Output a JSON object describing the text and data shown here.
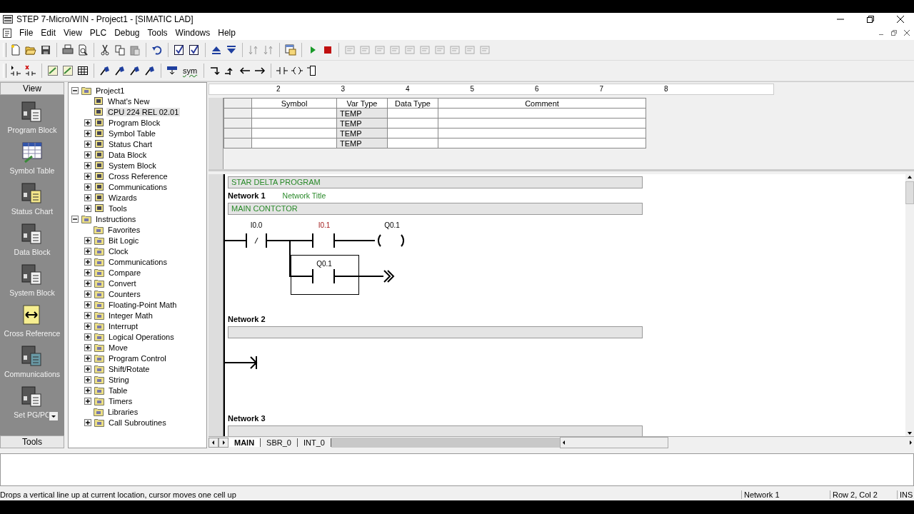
{
  "window": {
    "title": "STEP 7-Micro/WIN - Project1 - [SIMATIC LAD]"
  },
  "menu": [
    "File",
    "Edit",
    "View",
    "PLC",
    "Debug",
    "Tools",
    "Windows",
    "Help"
  ],
  "toolbar": {
    "symbol_button": "sym"
  },
  "navigation_bar": {
    "header": "View",
    "footer": "Tools",
    "items": [
      {
        "label": "Program Block"
      },
      {
        "label": "Symbol Table"
      },
      {
        "label": "Status Chart"
      },
      {
        "label": "Data Block"
      },
      {
        "label": "System Block"
      },
      {
        "label": "Cross Reference"
      },
      {
        "label": "Communications"
      },
      {
        "label": "Set PG/PC"
      }
    ]
  },
  "tree": [
    {
      "label": "Project1",
      "kind": "group",
      "expanded": true,
      "selected": false,
      "children": [
        {
          "label": "What's New",
          "kind": "leaf",
          "selected": false
        },
        {
          "label": "CPU 224 REL 02.01",
          "kind": "leaf",
          "selected": true
        },
        {
          "label": "Program Block",
          "kind": "group",
          "expanded": false,
          "selected": false
        },
        {
          "label": "Symbol Table",
          "kind": "group",
          "expanded": false,
          "selected": false
        },
        {
          "label": "Status Chart",
          "kind": "group",
          "expanded": false,
          "selected": false
        },
        {
          "label": "Data Block",
          "kind": "group",
          "expanded": false,
          "selected": false
        },
        {
          "label": "System Block",
          "kind": "group",
          "expanded": false,
          "selected": false
        },
        {
          "label": "Cross Reference",
          "kind": "group",
          "expanded": false,
          "selected": false
        },
        {
          "label": "Communications",
          "kind": "group",
          "expanded": false,
          "selected": false
        },
        {
          "label": "Wizards",
          "kind": "group",
          "expanded": false,
          "selected": false
        },
        {
          "label": "Tools",
          "kind": "group",
          "expanded": false,
          "selected": false
        }
      ]
    },
    {
      "label": "Instructions",
      "kind": "group",
      "expanded": true,
      "selected": false,
      "children": [
        {
          "label": "Favorites",
          "kind": "leaf",
          "selected": false
        },
        {
          "label": "Bit Logic",
          "kind": "group",
          "expanded": false,
          "selected": false
        },
        {
          "label": "Clock",
          "kind": "group",
          "expanded": false,
          "selected": false
        },
        {
          "label": "Communications",
          "kind": "group",
          "expanded": false,
          "selected": false
        },
        {
          "label": "Compare",
          "kind": "group",
          "expanded": false,
          "selected": false
        },
        {
          "label": "Convert",
          "kind": "group",
          "expanded": false,
          "selected": false
        },
        {
          "label": "Counters",
          "kind": "group",
          "expanded": false,
          "selected": false
        },
        {
          "label": "Floating-Point Math",
          "kind": "group",
          "expanded": false,
          "selected": false
        },
        {
          "label": "Integer Math",
          "kind": "group",
          "expanded": false,
          "selected": false
        },
        {
          "label": "Interrupt",
          "kind": "group",
          "expanded": false,
          "selected": false
        },
        {
          "label": "Logical Operations",
          "kind": "group",
          "expanded": false,
          "selected": false
        },
        {
          "label": "Move",
          "kind": "group",
          "expanded": false,
          "selected": false
        },
        {
          "label": "Program Control",
          "kind": "group",
          "expanded": false,
          "selected": false
        },
        {
          "label": "Shift/Rotate",
          "kind": "group",
          "expanded": false,
          "selected": false
        },
        {
          "label": "String",
          "kind": "group",
          "expanded": false,
          "selected": false
        },
        {
          "label": "Table",
          "kind": "group",
          "expanded": false,
          "selected": false
        },
        {
          "label": "Timers",
          "kind": "group",
          "expanded": false,
          "selected": false
        },
        {
          "label": "Libraries",
          "kind": "leaf",
          "selected": false
        },
        {
          "label": "Call Subroutines",
          "kind": "group",
          "expanded": false,
          "selected": false
        }
      ]
    }
  ],
  "ruler": [
    "2",
    "3",
    "4",
    "5",
    "6",
    "7",
    "8"
  ],
  "variable_table": {
    "columns": [
      "Symbol",
      "Var Type",
      "Data Type",
      "Comment"
    ],
    "rows": [
      {
        "var_type": "TEMP"
      },
      {
        "var_type": "TEMP"
      },
      {
        "var_type": "TEMP"
      },
      {
        "var_type": "TEMP"
      }
    ]
  },
  "program": {
    "title": "STAR DELTA PROGRAM",
    "networks": [
      {
        "label": "Network 1",
        "title": "Network Title",
        "comment": "MAIN CONTCTOR",
        "kind": "rung",
        "operands": [
          {
            "text": "I0.0",
            "highlighted": false
          },
          {
            "text": "I0.1",
            "highlighted": true
          },
          {
            "text": "Q0.1",
            "highlighted": false
          },
          {
            "text": "Q0.1",
            "highlighted": false
          }
        ]
      },
      {
        "label": "Network 2",
        "kind": "open-wire"
      },
      {
        "label": "Network 3",
        "kind": "empty"
      }
    ]
  },
  "tabs": [
    {
      "label": "MAIN",
      "selected": true
    },
    {
      "label": "SBR_0",
      "selected": false
    },
    {
      "label": "INT_0",
      "selected": false
    }
  ],
  "status_bar": {
    "message": "Drops a vertical line up at current location, cursor moves one cell up",
    "network": "Network 1",
    "position": "Row 2, Col 2",
    "mode": "INS"
  }
}
